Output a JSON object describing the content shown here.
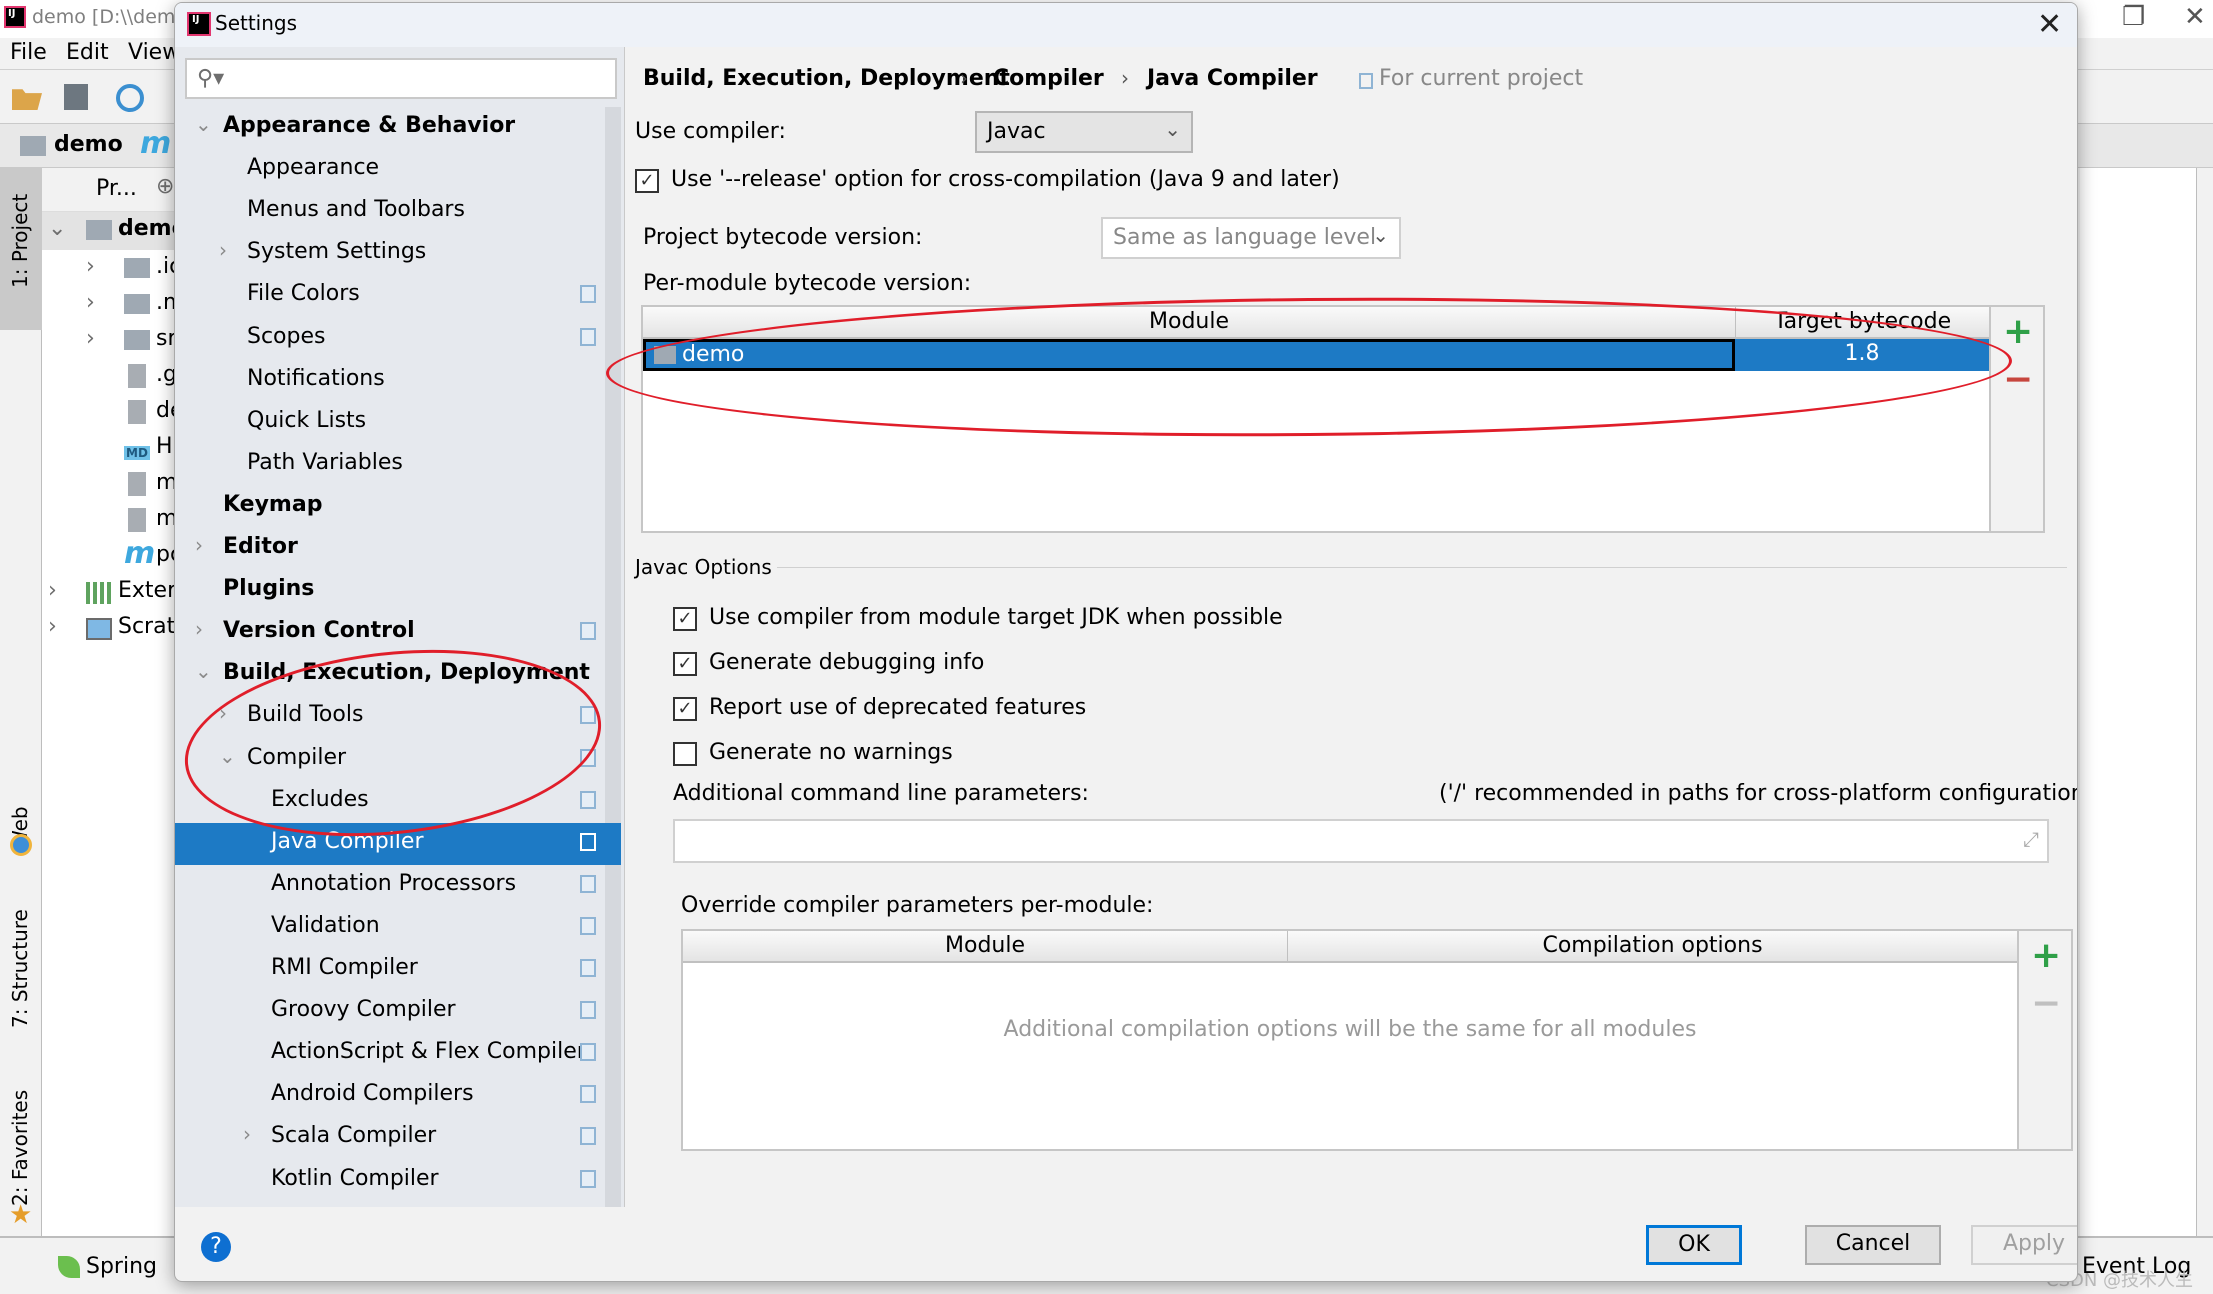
{
  "ide": {
    "title": "demo [D:\\\\demo]",
    "menu": [
      {
        "label": "File",
        "mnemonic": "F"
      },
      {
        "label": "Edit",
        "mnemonic": "E"
      },
      {
        "label": "View",
        "mnemonic": "V"
      }
    ],
    "nav": {
      "project": "demo",
      "module_glyph": "m"
    },
    "project_panel": {
      "header": "Pr...",
      "root": "demo",
      "items": [
        ".ic",
        ".m",
        "sr",
        ".g",
        "de",
        "HI",
        "m",
        "m",
        "pc"
      ],
      "external": "Exterr",
      "scratches": "Scratc"
    },
    "left_tabs": {
      "project": "1: Project",
      "web": "Web",
      "structure": "7: Structure",
      "favorites": "2: Favorites"
    },
    "bottom": {
      "spring": "Spring",
      "event_log": "Event Log"
    },
    "watermark": "CSDN @技术人生"
  },
  "dialog": {
    "title": "Settings",
    "search": {
      "placeholder": "",
      "value": ""
    },
    "tree": [
      {
        "label": "Appearance & Behavior",
        "level": 0,
        "bold": true,
        "chevron": "down",
        "proj": false
      },
      {
        "label": "Appearance",
        "level": 1,
        "bold": false,
        "chevron": "",
        "proj": false
      },
      {
        "label": "Menus and Toolbars",
        "level": 1,
        "bold": false,
        "chevron": "",
        "proj": false
      },
      {
        "label": "System Settings",
        "level": 1,
        "bold": false,
        "chevron": "right",
        "proj": false
      },
      {
        "label": "File Colors",
        "level": 1,
        "bold": false,
        "chevron": "",
        "proj": true
      },
      {
        "label": "Scopes",
        "level": 1,
        "bold": false,
        "chevron": "",
        "proj": true
      },
      {
        "label": "Notifications",
        "level": 1,
        "bold": false,
        "chevron": "",
        "proj": false
      },
      {
        "label": "Quick Lists",
        "level": 1,
        "bold": false,
        "chevron": "",
        "proj": false
      },
      {
        "label": "Path Variables",
        "level": 1,
        "bold": false,
        "chevron": "",
        "proj": false
      },
      {
        "label": "Keymap",
        "level": 0,
        "bold": true,
        "chevron": "",
        "proj": false
      },
      {
        "label": "Editor",
        "level": 0,
        "bold": true,
        "chevron": "right",
        "proj": false
      },
      {
        "label": "Plugins",
        "level": 0,
        "bold": true,
        "chevron": "",
        "proj": false
      },
      {
        "label": "Version Control",
        "level": 0,
        "bold": true,
        "chevron": "right",
        "proj": true
      },
      {
        "label": "Build, Execution, Deployment",
        "level": 0,
        "bold": true,
        "chevron": "down",
        "proj": false
      },
      {
        "label": "Build Tools",
        "level": 1,
        "bold": false,
        "chevron": "right",
        "proj": true
      },
      {
        "label": "Compiler",
        "level": 1,
        "bold": false,
        "chevron": "down",
        "proj": true
      },
      {
        "label": "Excludes",
        "level": 2,
        "bold": false,
        "chevron": "",
        "proj": true
      },
      {
        "label": "Java Compiler",
        "level": 2,
        "bold": false,
        "chevron": "",
        "proj": true,
        "selected": true
      },
      {
        "label": "Annotation Processors",
        "level": 2,
        "bold": false,
        "chevron": "",
        "proj": true
      },
      {
        "label": "Validation",
        "level": 2,
        "bold": false,
        "chevron": "",
        "proj": true
      },
      {
        "label": "RMI Compiler",
        "level": 2,
        "bold": false,
        "chevron": "",
        "proj": true
      },
      {
        "label": "Groovy Compiler",
        "level": 2,
        "bold": false,
        "chevron": "",
        "proj": true
      },
      {
        "label": "ActionScript & Flex Compiler",
        "level": 2,
        "bold": false,
        "chevron": "",
        "proj": true
      },
      {
        "label": "Android Compilers",
        "level": 2,
        "bold": false,
        "chevron": "",
        "proj": true
      },
      {
        "label": "Scala Compiler",
        "level": 2,
        "bold": false,
        "chevron": "right",
        "proj": true
      },
      {
        "label": "Kotlin Compiler",
        "level": 2,
        "bold": false,
        "chevron": "",
        "proj": true
      }
    ],
    "breadcrumb": [
      "Build, Execution, Deployment",
      "Compiler",
      "Java Compiler"
    ],
    "for_current_project": "For current project",
    "use_compiler": {
      "label": "Use compiler:",
      "value": "Javac"
    },
    "release_option": {
      "label": "Use '--release' option for cross-compilation (Java 9 and later)",
      "checked": true
    },
    "project_bytecode": {
      "label": "Project bytecode version:",
      "value": "Same as language level"
    },
    "per_module": {
      "label": "Per-module bytecode version:",
      "columns": [
        "Module",
        "Target bytecode version"
      ],
      "rows": [
        {
          "module": "demo",
          "version": "1.8"
        }
      ]
    },
    "javac_options": {
      "title": "Javac Options",
      "checkboxes": [
        {
          "label": "Use compiler from module target JDK when possible",
          "checked": true
        },
        {
          "label": "Generate debugging info",
          "checked": true
        },
        {
          "label": "Report use of deprecated features",
          "checked": true
        },
        {
          "label": "Generate no warnings",
          "checked": false
        }
      ],
      "additional_params_label": "Additional command line parameters:",
      "additional_params_hint": "('/' recommended in paths for cross-platform configurations)",
      "additional_params_value": ""
    },
    "override": {
      "label": "Override compiler parameters per-module:",
      "columns": [
        "Module",
        "Compilation options"
      ],
      "empty_text": "Additional compilation options will be the same for all modules"
    },
    "buttons": {
      "ok": "OK",
      "cancel": "Cancel",
      "apply": "Apply",
      "help": "?"
    },
    "icons": {
      "check": "✓",
      "chevron_down": "⌄",
      "plus": "+",
      "minus": "−",
      "close": "✕"
    }
  }
}
